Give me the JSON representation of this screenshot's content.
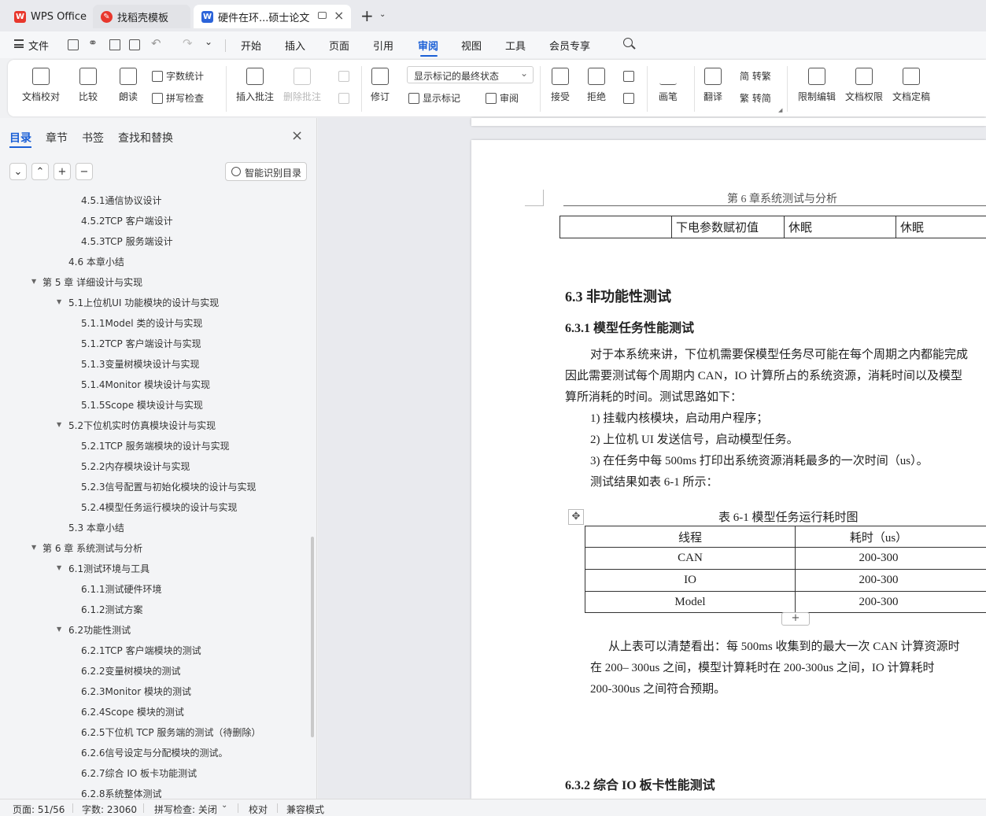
{
  "titlebar": {
    "tabs": [
      {
        "label": "WPS Office",
        "icon": "wps-logo-icon"
      },
      {
        "label": "找稻壳模板",
        "icon": "docer-logo-icon"
      },
      {
        "label": "硬件在环...硕士论文",
        "icon": "writer-doc-icon",
        "active": true
      }
    ],
    "new_tab": "+"
  },
  "menubar": {
    "file": "文件",
    "items": [
      "开始",
      "插入",
      "页面",
      "引用",
      "审阅",
      "视图",
      "工具",
      "会员专享"
    ],
    "active": "审阅"
  },
  "ribbon": {
    "proofread": "文档校对",
    "compare": "比较",
    "read_aloud": "朗读",
    "word_count": "字数统计",
    "spell_check": "拼写检查",
    "insert_comment": "插入批注",
    "delete_comment": "删除批注",
    "track": "修订",
    "markup_state": "显示标记的最终状态",
    "show_markup": "显示标记",
    "review": "审阅",
    "accept": "接受",
    "reject": "拒绝",
    "pen": "画笔",
    "translate": "翻译",
    "to_traditional": "简 转繁",
    "to_simplified": "繁 转简",
    "restrict_edit": "限制编辑",
    "doc_permission": "文档权限",
    "doc_finalize": "文档定稿"
  },
  "sidepanel": {
    "tabs": [
      "目录",
      "章节",
      "书签",
      "查找和替换"
    ],
    "smart_toc": "智能识别目录",
    "toc": [
      {
        "text": "4.5.1通信协议设计",
        "level": 3
      },
      {
        "text": "4.5.2TCP 客户端设计",
        "level": 3
      },
      {
        "text": "4.5.3TCP 服务端设计",
        "level": 3
      },
      {
        "text": "4.6 本章小结",
        "level": 2
      },
      {
        "text": "第 5 章 详细设计与实现",
        "level": 1,
        "expanded": true
      },
      {
        "text": "5.1上位机UI 功能模块的设计与实现",
        "level": 2,
        "expanded": true
      },
      {
        "text": "5.1.1Model 类的设计与实现",
        "level": 3
      },
      {
        "text": "5.1.2TCP 客户端设计与实现",
        "level": 3
      },
      {
        "text": "5.1.3变量树模块设计与实现",
        "level": 3
      },
      {
        "text": "5.1.4Monitor 模块设计与实现",
        "level": 3
      },
      {
        "text": "5.1.5Scope 模块设计与实现",
        "level": 3
      },
      {
        "text": "5.2下位机实时仿真模块设计与实现",
        "level": 2,
        "expanded": true
      },
      {
        "text": "5.2.1TCP 服务端模块的设计与实现",
        "level": 3
      },
      {
        "text": "5.2.2内存模块设计与实现",
        "level": 3
      },
      {
        "text": "5.2.3信号配置与初始化模块的设计与实现",
        "level": 3
      },
      {
        "text": "5.2.4模型任务运行模块的设计与实现",
        "level": 3
      },
      {
        "text": "5.3 本章小结",
        "level": 2
      },
      {
        "text": "第 6 章 系统测试与分析",
        "level": 1,
        "expanded": true
      },
      {
        "text": "6.1测试环境与工具",
        "level": 2,
        "expanded": true
      },
      {
        "text": "6.1.1测试硬件环境",
        "level": 3
      },
      {
        "text": "6.1.2测试方案",
        "level": 3
      },
      {
        "text": "6.2功能性测试",
        "level": 2,
        "expanded": true
      },
      {
        "text": "6.2.1TCP 客户端模块的测试",
        "level": 3
      },
      {
        "text": "6.2.2变量树模块的测试",
        "level": 3
      },
      {
        "text": "6.2.3Monitor 模块的测试",
        "level": 3
      },
      {
        "text": "6.2.4Scope 模块的测试",
        "level": 3
      },
      {
        "text": "6.2.5下位机 TCP 服务端的测试（待删除）",
        "level": 3
      },
      {
        "text": "6.2.6信号设定与分配模块的测试。",
        "level": 3
      },
      {
        "text": "6.2.7综合 IO 板卡功能测试",
        "level": 3
      },
      {
        "text": "6.2.8系统整体测试",
        "level": 3
      }
    ]
  },
  "document": {
    "header": "第 6 章系统测试与分析",
    "prev_table_row": [
      "",
      "下电参数赋初值",
      "休眠",
      "休眠"
    ],
    "h2": "6.3 非功能性测试",
    "h3": "6.3.1 模型任务性能测试",
    "para1_line1": "对于本系统来讲，下位机需要保模型任务尽可能在每个周期之内都能完成",
    "para1_line2": "因此需要测试每个周期内  CAN，IO 计算所占的系统资源，消耗时间以及模型",
    "para1_line3": "算所消耗的时间。测试思路如下：",
    "list": [
      "1)   挂载内核模块，启动用户程序；",
      "2)   上位机  UI 发送信号，启动模型任务。",
      "3)   在任务中每  500ms 打印出系统资源消耗最多的一次时间（us）。"
    ],
    "result_intro": "测试结果如表  6-1 所示：",
    "table_caption": "表  6-1 模型任务运行耗时图",
    "table_headers": [
      "线程",
      "耗时（us）"
    ],
    "table_rows": [
      [
        "CAN",
        "200-300"
      ],
      [
        "IO",
        "200-300"
      ],
      [
        "Model",
        "200-300"
      ]
    ],
    "para2_line1": "从上表可以清楚看出：每  500ms 收集到的最大一次  CAN 计算资源时",
    "para2_line2": "在  200– 300us 之间，模型计算耗时在  200-300us 之间，IO 计算耗时",
    "para2_line3": "200-300us 之间符合预期。",
    "h3_next": "6.3.2 综合 IO 板卡性能测试"
  },
  "statusbar": {
    "page": "页面: 51/56",
    "words": "字数: 23060",
    "spell": "拼写检查: 关闭",
    "proof": "校对",
    "compat": "兼容模式"
  },
  "colors": {
    "accent": "#1a5fd6",
    "wps_red": "#e8372c",
    "active_tab": "#ffffff"
  }
}
